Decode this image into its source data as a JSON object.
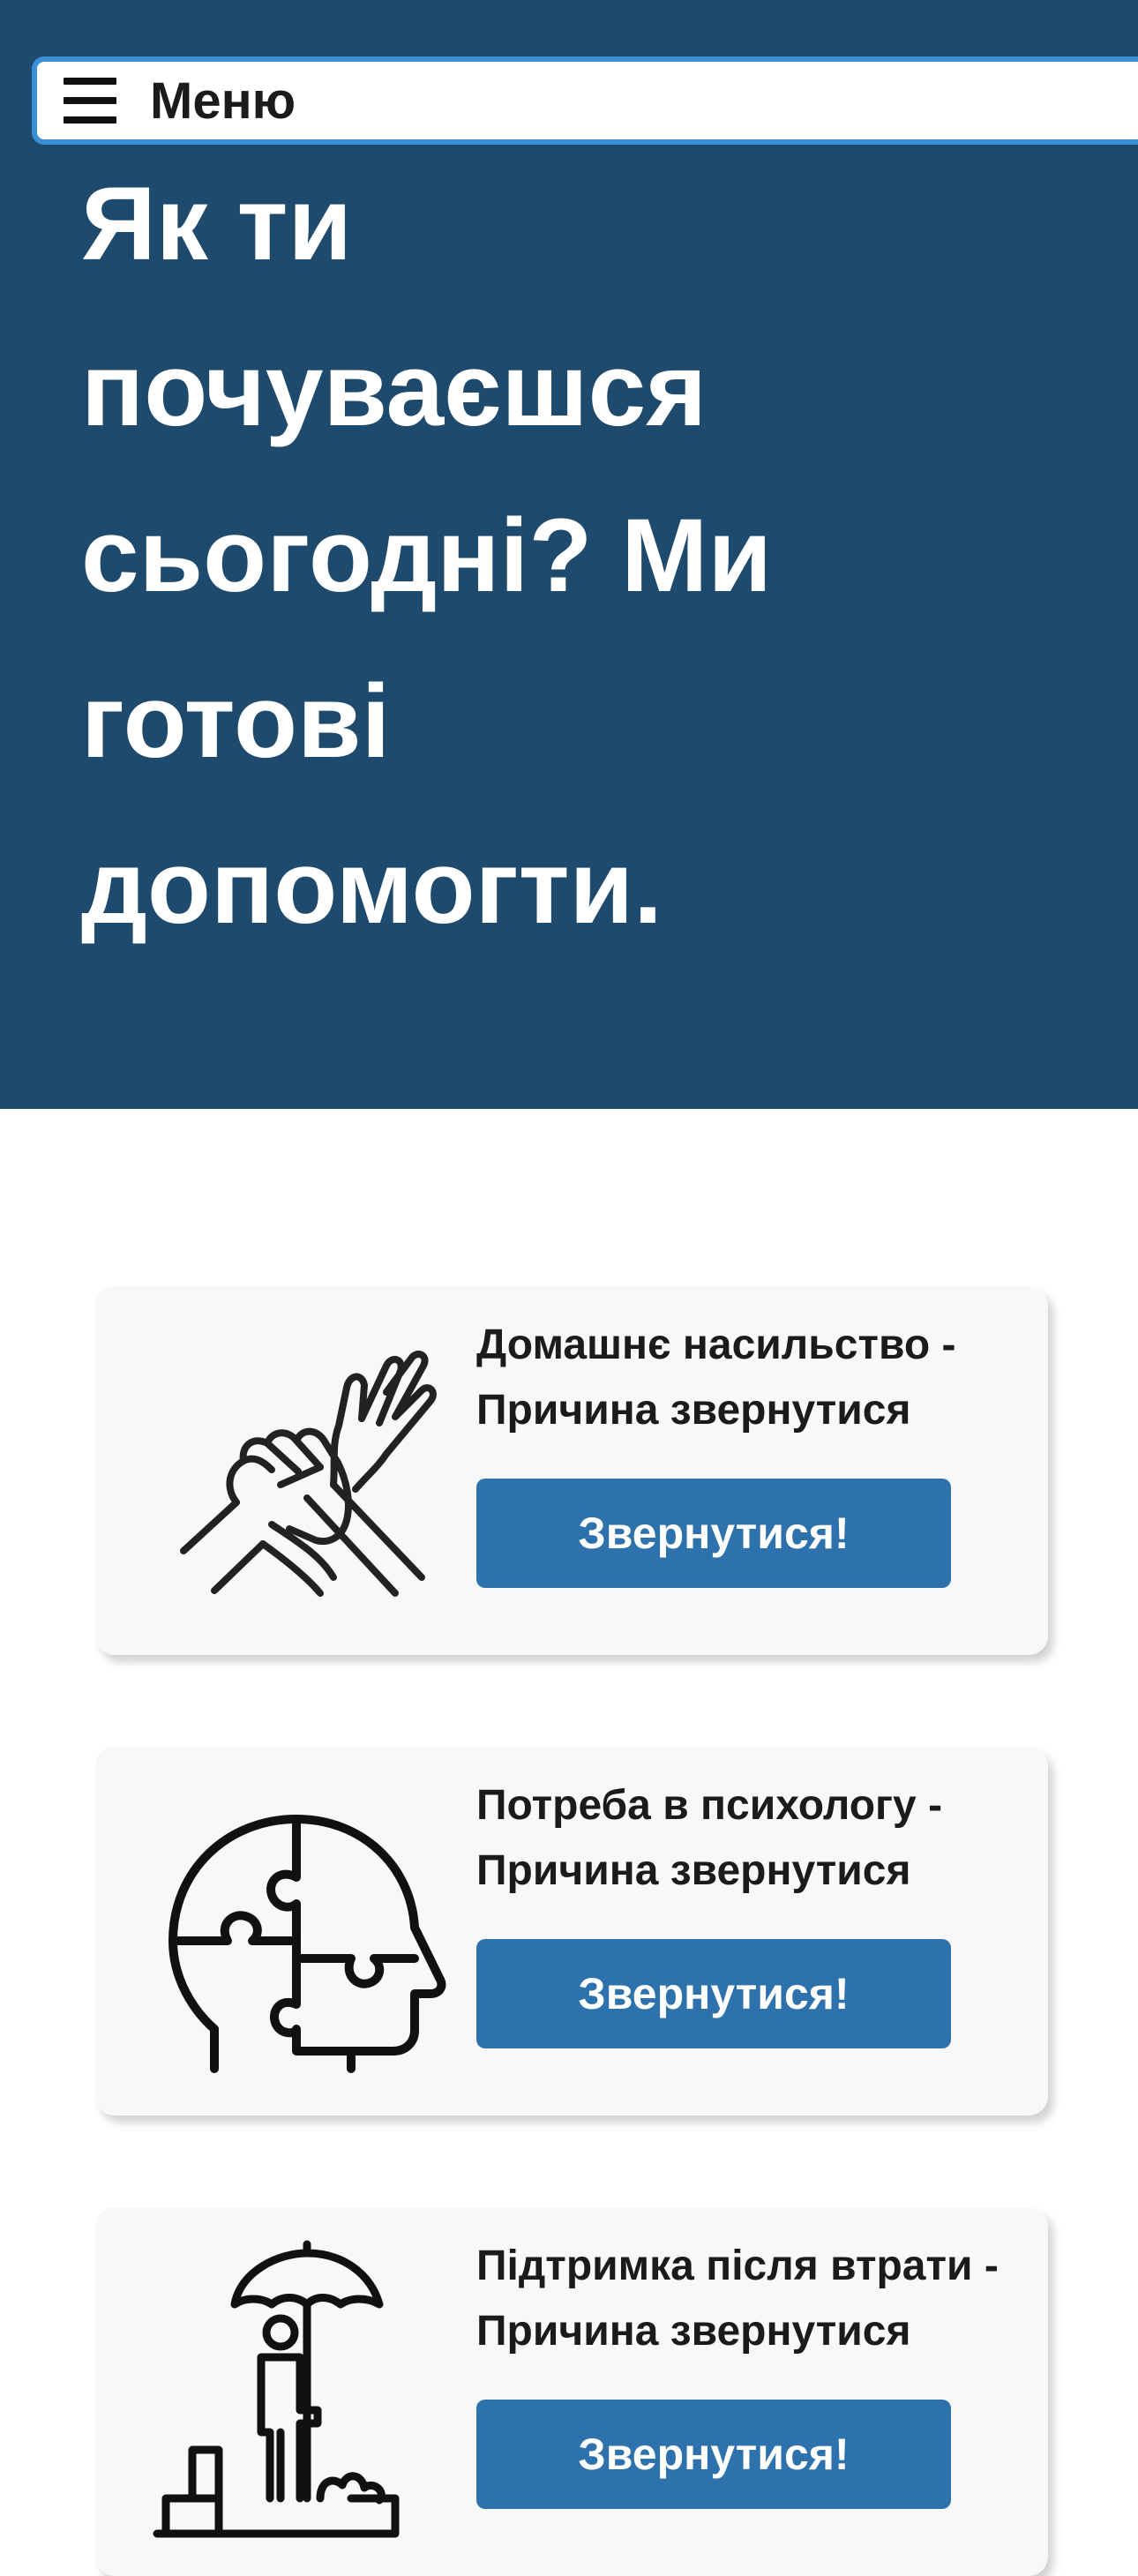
{
  "header": {
    "menu_label": "Меню",
    "menu_icon": "hamburger-icon"
  },
  "hero": {
    "title": "Як ти почуваєшся сьогодні? Ми готові допомогти."
  },
  "colors": {
    "hero_background": "#1e4a6e",
    "menu_border": "#3a8fd6",
    "button": "#2d72ad",
    "card_background": "#f8f8f8"
  },
  "cards": [
    {
      "title": "Домашнє насильство - Причина звернутися",
      "button_label": "Звернутися!",
      "icon": "hands-grab-wrist-icon"
    },
    {
      "title": "Потреба в психологу - Причина звернутися",
      "button_label": "Звернутися!",
      "icon": "head-puzzle-icon"
    },
    {
      "title": "Підтримка після втрати - Причина звернутися",
      "button_label": "Звернутися!",
      "icon": "grave-umbrella-icon"
    }
  ]
}
